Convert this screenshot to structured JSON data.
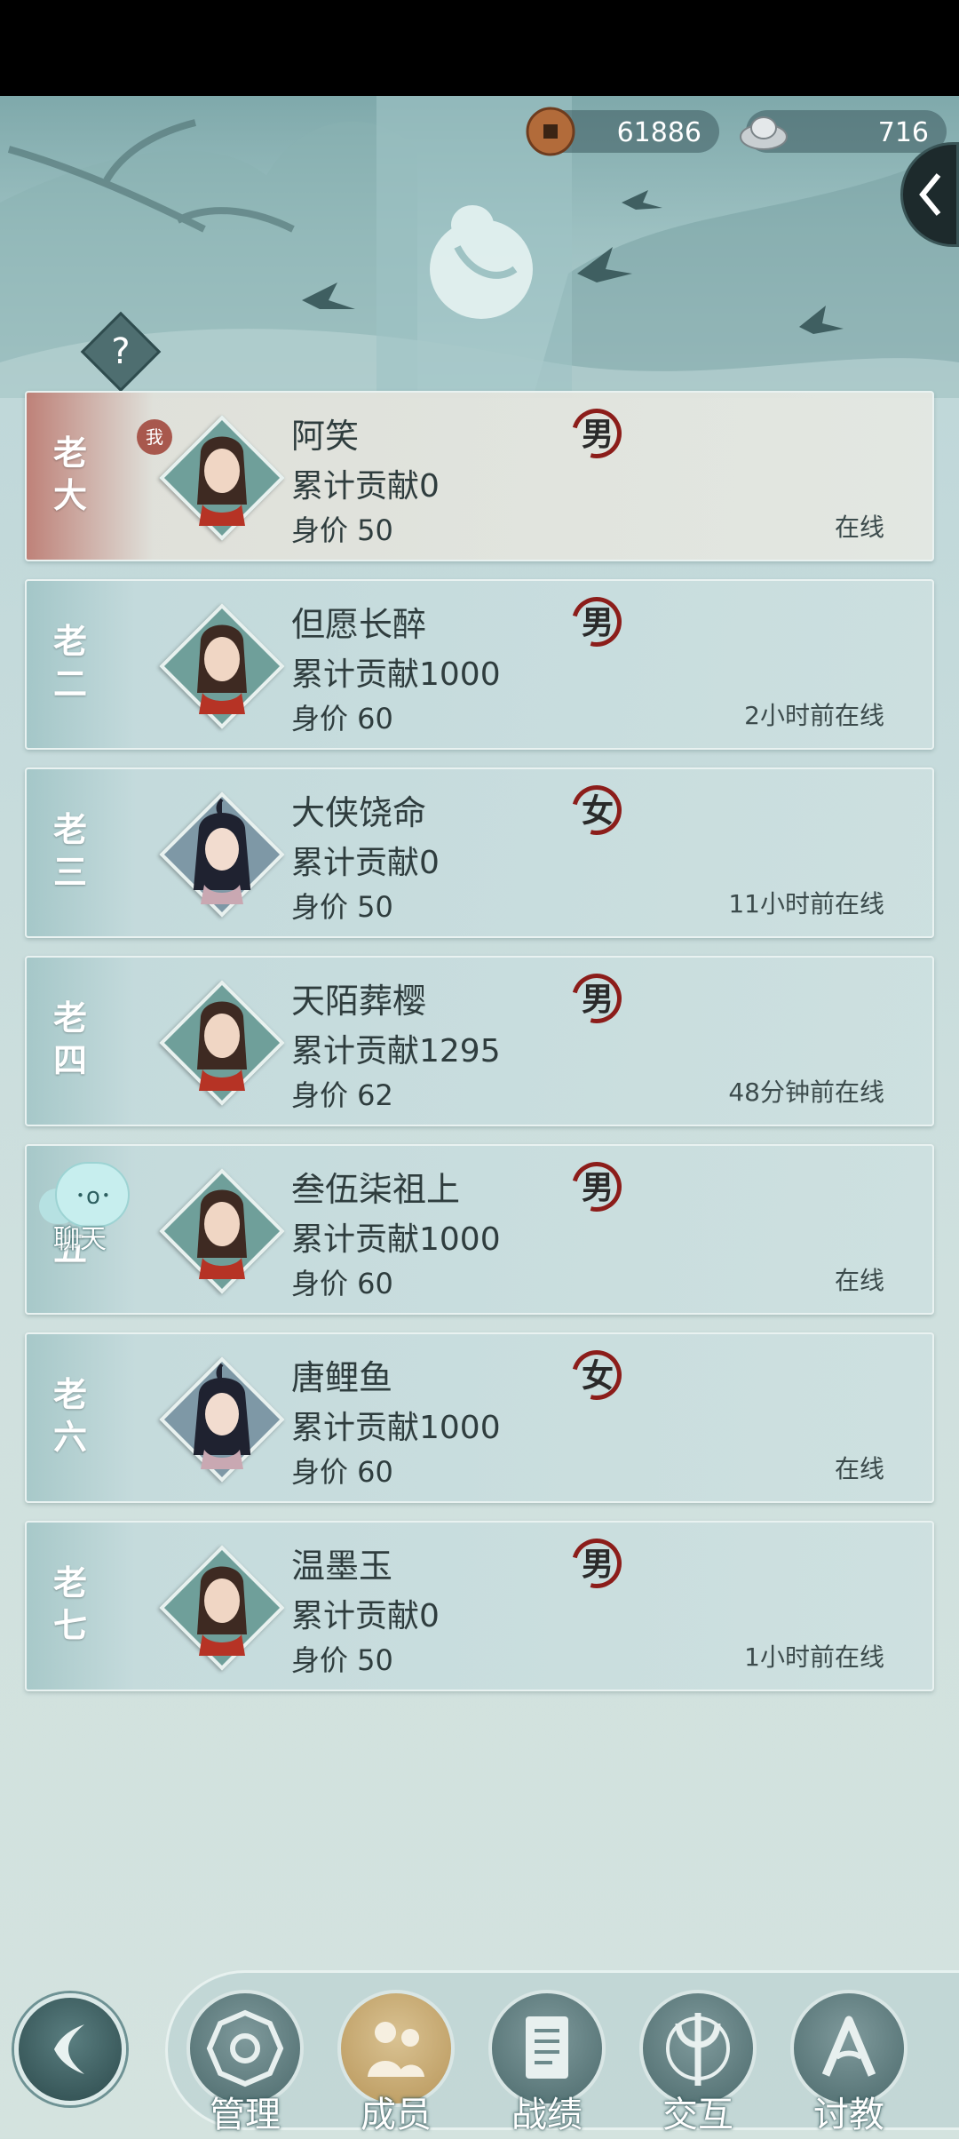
{
  "currency": {
    "copper": "61886",
    "silver": "716",
    "copper_icon": "copper-coin-icon",
    "silver_icon": "silver-ingot-icon"
  },
  "help_label": "?",
  "members": [
    {
      "rank": "老大",
      "name": "阿笑",
      "gender": "男",
      "contribution": "累计贡献0",
      "price": "身价 50",
      "status": "在线",
      "self": true,
      "self_badge": "我",
      "hair": "brown"
    },
    {
      "rank": "老二",
      "name": "但愿长醉",
      "gender": "男",
      "contribution": "累计贡献1000",
      "price": "身价 60",
      "status": "2小时前在线",
      "self": false,
      "hair": "brown"
    },
    {
      "rank": "老三",
      "name": "大侠饶命",
      "gender": "女",
      "contribution": "累计贡献0",
      "price": "身价 50",
      "status": "11小时前在线",
      "self": false,
      "hair": "dark"
    },
    {
      "rank": "老四",
      "name": "天陌葬樱",
      "gender": "男",
      "contribution": "累计贡献1295",
      "price": "身价 62",
      "status": "48分钟前在线",
      "self": false,
      "hair": "brown"
    },
    {
      "rank": "老五",
      "name": "叁伍柒祖上",
      "gender": "男",
      "contribution": "累计贡献1000",
      "price": "身价 60",
      "status": "在线",
      "self": false,
      "hair": "brown"
    },
    {
      "rank": "老六",
      "name": "唐鲤鱼",
      "gender": "女",
      "contribution": "累计贡献1000",
      "price": "身价 60",
      "status": "在线",
      "self": false,
      "hair": "dark"
    },
    {
      "rank": "老七",
      "name": "温墨玉",
      "gender": "男",
      "contribution": "累计贡献0",
      "price": "身价 50",
      "status": "1小时前在线",
      "self": false,
      "hair": "brown"
    }
  ],
  "chat": {
    "label": "聊天",
    "icon": "chat-bubble-icon"
  },
  "nav": [
    {
      "label": "管理",
      "icon": "manage-icon",
      "active": false
    },
    {
      "label": "成员",
      "icon": "members-icon",
      "active": true
    },
    {
      "label": "战绩",
      "icon": "record-scroll-icon",
      "active": false
    },
    {
      "label": "交互",
      "icon": "trident-icon",
      "active": false
    },
    {
      "label": "讨教",
      "icon": "challenge-icon",
      "active": false
    }
  ],
  "colors": {
    "self_rank_bg": "#b8756a",
    "gender_ring": "#8c1d1a",
    "nav_active": "#c9ab72"
  }
}
